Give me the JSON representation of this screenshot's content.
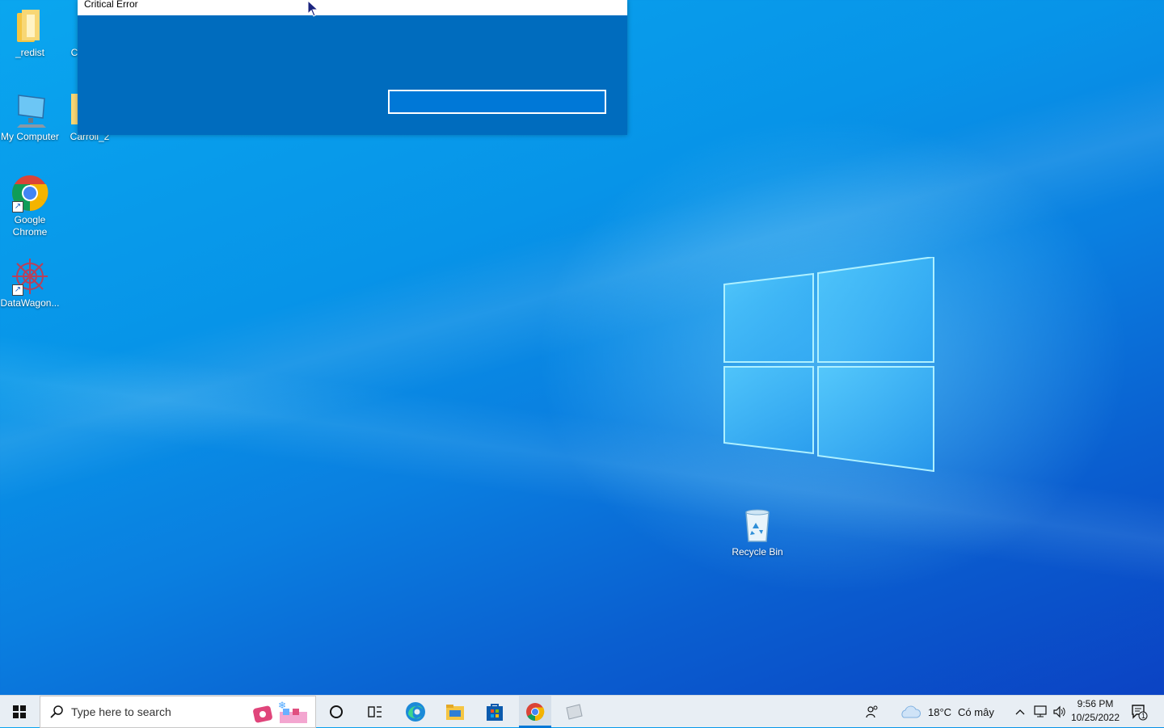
{
  "desktop": {
    "icons": [
      {
        "label": "_redist"
      },
      {
        "label": "C"
      },
      {
        "label": "My Computer"
      },
      {
        "label": "Carroll_2"
      },
      {
        "label": "Google Chrome"
      },
      {
        "label": "DataWagon..."
      },
      {
        "label": "Recycle Bin"
      }
    ]
  },
  "dialog": {
    "title": "Critical Error",
    "input_value": ""
  },
  "taskbar": {
    "search_placeholder": "Type here to search",
    "weather": {
      "temperature": "18°C",
      "condition": "Có mây"
    },
    "clock": {
      "time": "9:56 PM",
      "date": "10/25/2022"
    },
    "notification_count": "1",
    "pinned_apps": [
      "start-icon",
      "cortana-icon",
      "task-view-icon",
      "edge-icon",
      "file-explorer-icon",
      "store-icon",
      "chrome-icon",
      "app-icon"
    ]
  },
  "colors": {
    "accent": "#0078d7",
    "dialog_bg": "#006cbe"
  }
}
